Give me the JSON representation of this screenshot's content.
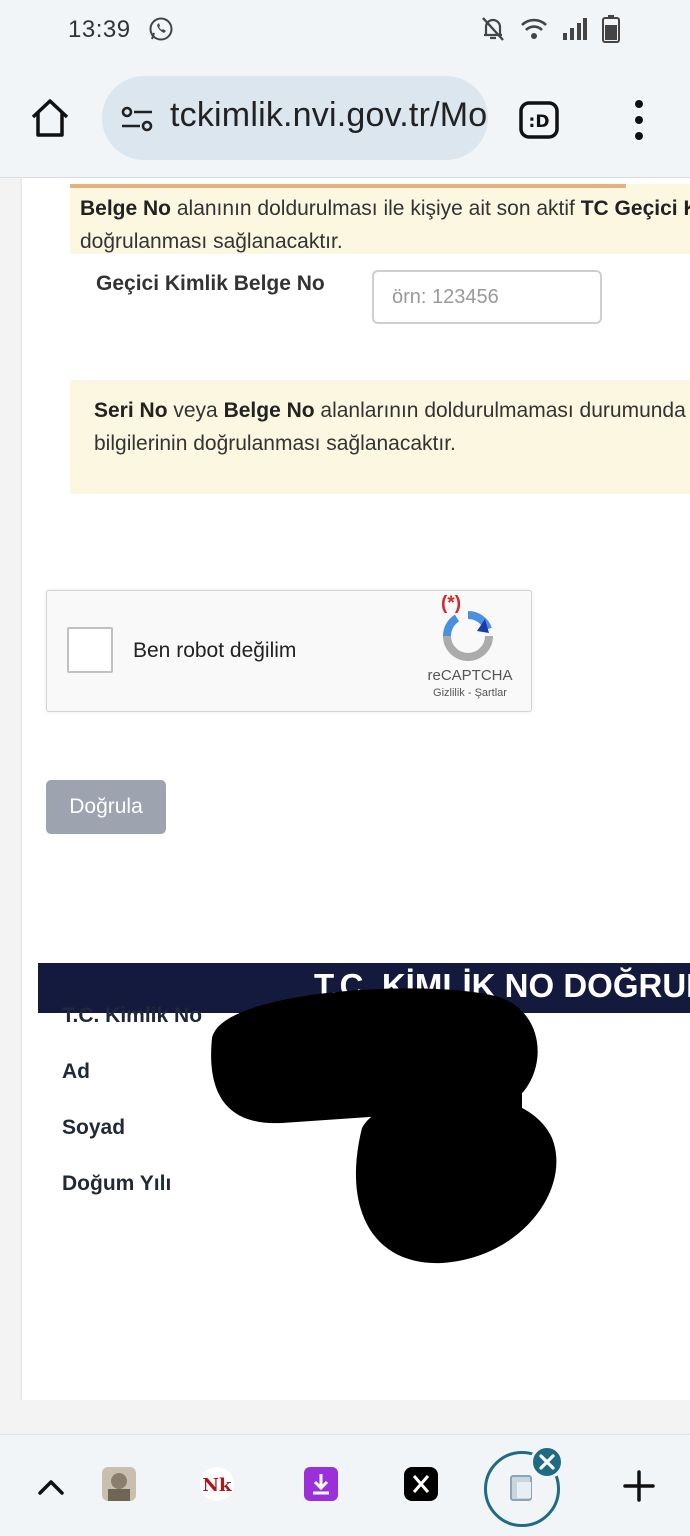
{
  "status_bar": {
    "time": "13:39"
  },
  "browser": {
    "url": "tckimlik.nvi.gov.tr/Modul/KisiKimlikDogrula"
  },
  "notice_top": {
    "bold1": "Belge No",
    "text1": " alanının doldurulması ile kişiye ait son aktif ",
    "bold2": "TC Geçici Kimlik Belgesi",
    "line2": "doğrulanması sağlanacaktır."
  },
  "temp_id_field": {
    "label": "Geçici Kimlik Belge No",
    "placeholder": "örn: 123456"
  },
  "notice_mid": {
    "bold1": "Seri No",
    "text1": " veya ",
    "bold2": "Belge No",
    "text2": " alanlarının doldurulmaması durumunda",
    "line2": "bilgilerinin doğrulanması sağlanacaktır."
  },
  "recaptcha": {
    "label": "Ben robot değilim",
    "required_mark": "(*)",
    "brand": "reCAPTCHA",
    "links": "Gizlilik - Şartlar"
  },
  "verify_button": {
    "label": "Doğrula"
  },
  "result": {
    "header": "T.C. KİMLİK NO DOĞRULAMA",
    "rows": [
      {
        "label": "T.C. Kimlik No"
      },
      {
        "label": "Ad"
      },
      {
        "label": "Soyad"
      },
      {
        "label": "Doğum Yılı"
      }
    ]
  },
  "colors": {
    "notice_bg": "#fcf7e0",
    "result_header_bg": "#141a3d",
    "button_disabled": "#9ea3b0",
    "active_tab_ring": "#1f6b84"
  },
  "tab_icons": [
    "chevron-up-icon",
    "tab-thumbnail-icon",
    "nk-icon",
    "download-icon",
    "x-icon",
    "active-tab-icon",
    "close-icon",
    "plus-icon"
  ]
}
